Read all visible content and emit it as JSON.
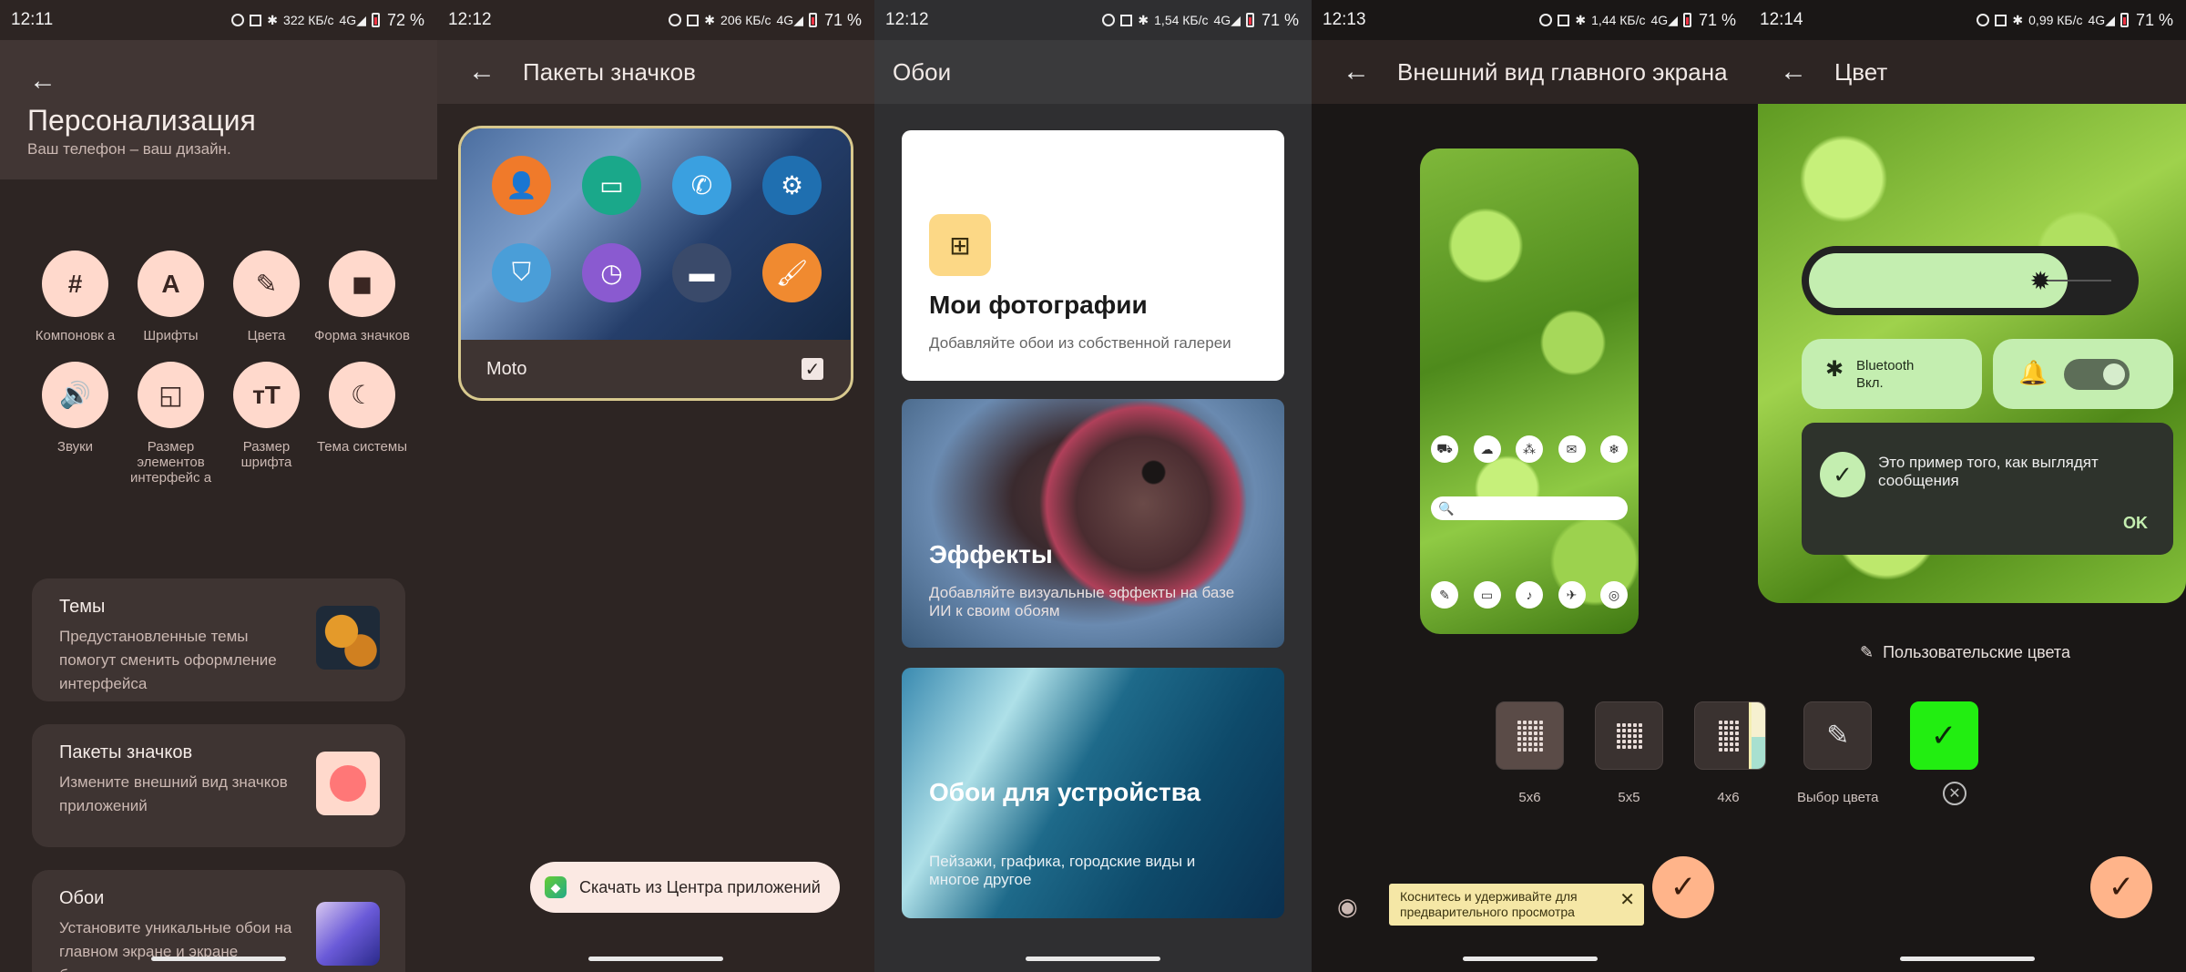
{
  "screens": [
    {
      "time": "12:11",
      "signal": "322 КБ/с",
      "battery": "72 %",
      "title": "Персонализация",
      "subtitle": "Ваш телефон – ваш дизайн.",
      "grid": [
        {
          "label": "Компоновк а",
          "icon": "#"
        },
        {
          "label": "Шрифты",
          "icon": "A"
        },
        {
          "label": "Цвета",
          "icon": "✎"
        },
        {
          "label": "Форма значков",
          "icon": "◼"
        },
        {
          "label": "Звуки",
          "icon": "🔊"
        },
        {
          "label": "Размер элементов интерфейс а",
          "icon": "◱"
        },
        {
          "label": "Размер шрифта",
          "icon": "ᴛT"
        },
        {
          "label": "Тема системы",
          "icon": "☾"
        }
      ],
      "cards": [
        {
          "title": "Темы",
          "desc": "Предустановленные темы помогут сменить оформление интерфейса"
        },
        {
          "title": "Пакеты значков",
          "desc": "Измените внешний вид значков приложений"
        },
        {
          "title": "Обои",
          "desc": "Установите уникальные обои на главном экране и экране блокировки"
        }
      ]
    },
    {
      "time": "12:12",
      "signal": "206 КБ/с",
      "battery": "71 %",
      "title": "Пакеты значков",
      "pack_name": "Moto",
      "download_label": "Скачать из Центра приложений"
    },
    {
      "time": "12:12",
      "signal": "1,54 КБ/с",
      "battery": "71 %",
      "title": "Обои",
      "cards": [
        {
          "title": "Мои фотографии",
          "desc": "Добавляйте обои из собственной галереи"
        },
        {
          "title": "Эффекты",
          "desc": "Добавляйте визуальные эффекты на базе ИИ к своим обоям"
        },
        {
          "title": "Обои для устройства",
          "desc": "Пейзажи, графика, городские виды и многое другое"
        }
      ]
    },
    {
      "time": "12:13",
      "signal": "1,44 КБ/с",
      "battery": "71 %",
      "title": "Внешний вид главного экрана",
      "grid_options": [
        "5x6",
        "5x5",
        "4x6"
      ],
      "tip": "Коснитесь и удерживайте для предварительного просмотра"
    },
    {
      "time": "12:14",
      "signal": "0,99 КБ/с",
      "battery": "71 %",
      "title": "Цвет",
      "bt_title": "Bluetooth",
      "bt_state": "Вкл.",
      "message": "Это пример того, как выглядят сообщения",
      "ok": "OK",
      "custom_colors": "Пользовательские цвета",
      "color_picker": "Выбор цвета"
    }
  ],
  "colors": {
    "accent": "#ffd9cc",
    "fab": "#ffb48a",
    "selected_color": "#22ee11"
  }
}
